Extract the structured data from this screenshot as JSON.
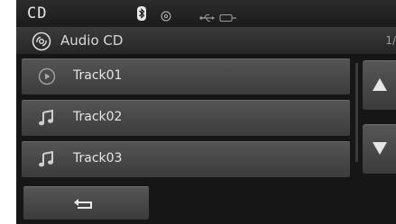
{
  "status_bar": {
    "title": "CD",
    "icons": [
      "bluetooth-icon",
      "cd-disc-icon",
      "usb-icon",
      "aux-icon"
    ]
  },
  "header": {
    "label": "Audio CD",
    "icon": "audio-cd-icon",
    "page_indicator": "1/"
  },
  "tracks": [
    {
      "label": "Track01",
      "icon": "play-circle-icon",
      "playing": true
    },
    {
      "label": "Track02",
      "icon": "music-note-icon",
      "playing": false
    },
    {
      "label": "Track03",
      "icon": "music-note-icon",
      "playing": false
    }
  ],
  "scroll": {
    "up_icon": "arrow-up-icon",
    "down_icon": "arrow-down-icon"
  },
  "footer": {
    "back_icon": "return-icon"
  }
}
